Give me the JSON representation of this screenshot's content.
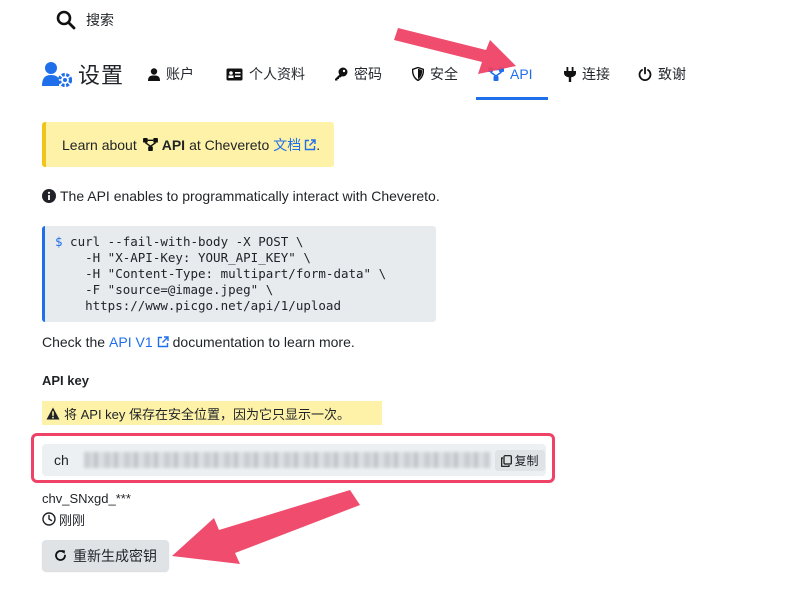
{
  "search": {
    "label": "搜索",
    "icon": "search-icon"
  },
  "header": {
    "title": "设置",
    "icon": "user-cog-icon"
  },
  "tabs": [
    {
      "label": "账户",
      "icon": "user-icon"
    },
    {
      "label": "个人资料",
      "icon": "id-card-icon"
    },
    {
      "label": "密码",
      "icon": "key-icon"
    },
    {
      "label": "安全",
      "icon": "shield-icon"
    },
    {
      "label": "API",
      "icon": "api-nodes-icon",
      "active": true
    },
    {
      "label": "连接",
      "icon": "plug-icon"
    },
    {
      "label": "致谢",
      "icon": "power-icon"
    }
  ],
  "notice": {
    "prefix": "Learn about",
    "api": "API",
    "middle": "at Chevereto",
    "link": "文档",
    "suffix": "."
  },
  "info": {
    "text": "The API enables to programmatically interact with Chevereto."
  },
  "code": {
    "prompt": "$",
    "text": " curl --fail-with-body -X POST \\\n    -H \"X-API-Key: YOUR_API_KEY\" \\\n    -H \"Content-Type: multipart/form-data\" \\\n    -F \"source=@image.jpeg\" \\\n    https://www.picgo.net/api/1/upload"
  },
  "check": {
    "prefix": "Check the",
    "link": "API V1",
    "suffix": "documentation to learn more."
  },
  "api_key": {
    "label": "API key",
    "warning": "将 API key 保存在安全位置，因为它只显示一次。",
    "value_visible": "ch",
    "copy_label": "复制",
    "key_name": "chv_SNxgd_***",
    "time": "刚刚",
    "regenerate_label": "重新生成密钥"
  },
  "colors": {
    "accent": "#1f6feb",
    "highlight": "#fdf2a7",
    "annotation": "#ee4266"
  }
}
